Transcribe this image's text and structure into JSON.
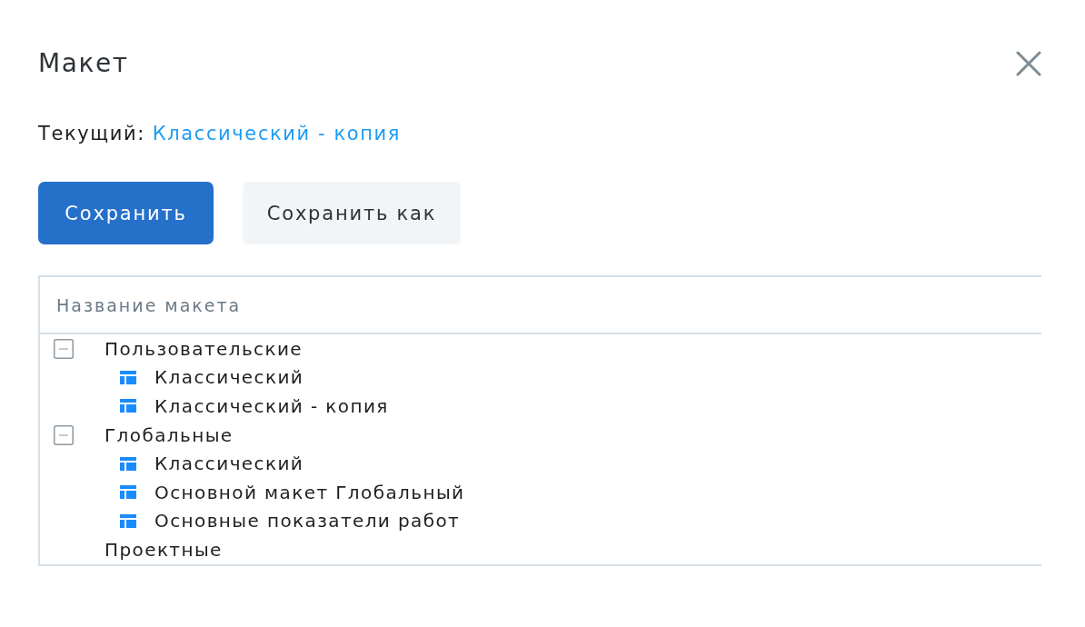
{
  "dialog": {
    "title": "Макет"
  },
  "current": {
    "label": "Текущий:",
    "value": "Классический - копия"
  },
  "buttons": [
    {
      "label": "Сохранить",
      "kind": "primary"
    },
    {
      "label": "Сохранить как",
      "kind": "secondary"
    }
  ],
  "table": {
    "columns": [
      "Название макета"
    ],
    "tree": [
      {
        "label": "Пользовательские",
        "expanded": true,
        "children": [
          {
            "label": "Классический"
          },
          {
            "label": "Классический - копия"
          }
        ]
      },
      {
        "label": "Глобальные",
        "expanded": true,
        "children": [
          {
            "label": "Классический"
          },
          {
            "label": "Основной макет Глобальный"
          },
          {
            "label": "Основные показатели работ"
          }
        ]
      },
      {
        "label": "Проектные"
      }
    ]
  }
}
